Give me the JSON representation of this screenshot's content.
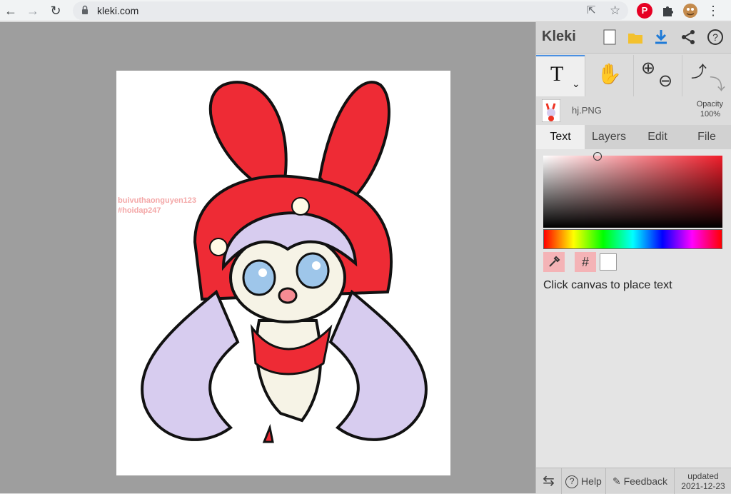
{
  "browser": {
    "url": "kleki.com",
    "back_icon": "←",
    "forward_icon": "→",
    "reload_icon": "↻",
    "share_icon": "⇱",
    "star_icon": "☆",
    "menu_icon": "⋮"
  },
  "app": {
    "logo": "Kleki",
    "accent": "#4a90e2"
  },
  "tools": {
    "text_glyph": "T",
    "dropdown_glyph": "⌄",
    "hand_glyph": "✋",
    "zoom_in_glyph": "⊕",
    "zoom_out_glyph": "⊖",
    "undo_glyph": "⤴",
    "redo_glyph": "⤵"
  },
  "layer": {
    "file_name": "hj.PNG",
    "opacity_label": "Opacity",
    "opacity_value": "100%"
  },
  "tabs": [
    {
      "label": "Text"
    },
    {
      "label": "Layers"
    },
    {
      "label": "Edit"
    },
    {
      "label": "File"
    }
  ],
  "color": {
    "current": "#ffffff",
    "hue_base": "#f01d2a",
    "hex_symbol": "#"
  },
  "text_tool": {
    "hint": "Click canvas to place text"
  },
  "canvas": {
    "watermark_line1": "buivuthaonguyen123",
    "watermark_line2": "#hoidap247"
  },
  "footer": {
    "help_label": "Help",
    "feedback_label": "Feedback",
    "updated_label": "updated",
    "updated_date": "2021-12-23"
  }
}
